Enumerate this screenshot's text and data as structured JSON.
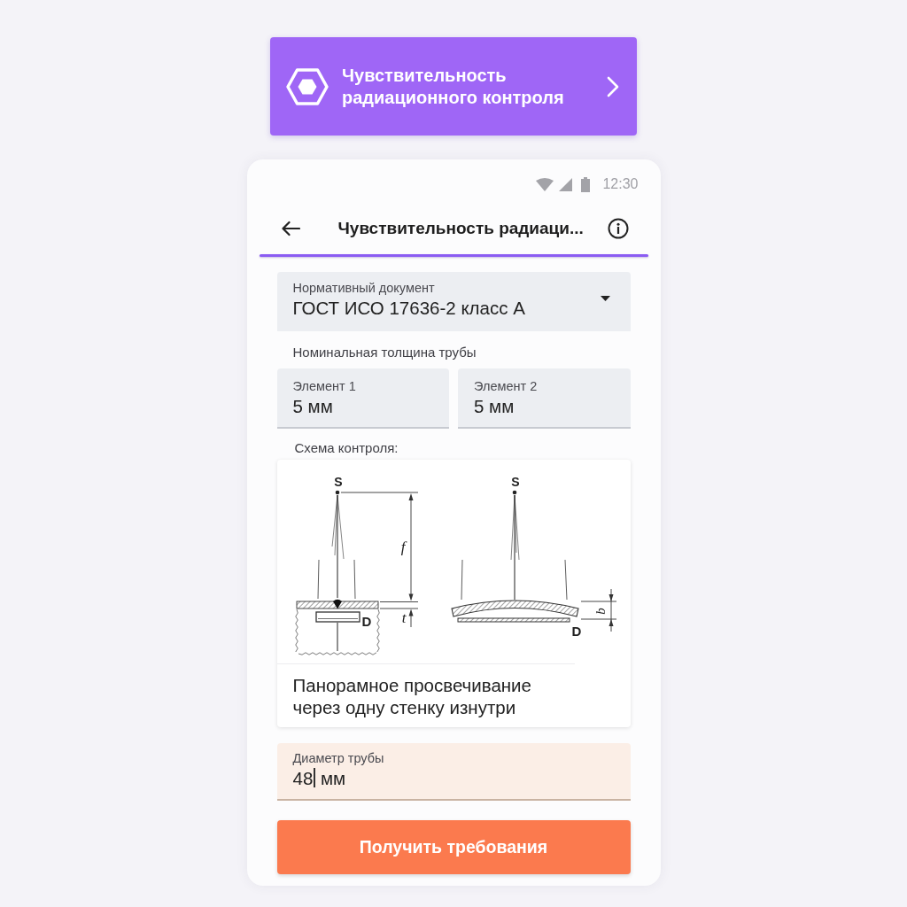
{
  "banner": {
    "title": "Чувствительность радиационного контроля"
  },
  "status_bar": {
    "time": "12:30"
  },
  "app_bar": {
    "title": "Чувствительность радиаци..."
  },
  "document_field": {
    "label": "Нормативный документ",
    "value": "ГОСТ ИСО 17636-2 класс А"
  },
  "thickness": {
    "label": "Номинальная толщина трубы",
    "fields": [
      {
        "label": "Элемент 1",
        "value": "5 мм"
      },
      {
        "label": "Элемент 2",
        "value": "5 мм"
      }
    ]
  },
  "scheme": {
    "label": "Схема контроля:",
    "diagram": {
      "left": {
        "source_label": "S",
        "distance_label": "f",
        "thickness_label": "t",
        "detector_label": "D"
      },
      "right": {
        "source_label": "S",
        "gap_label": "b",
        "detector_label": "D"
      }
    },
    "description": "Панорамное просвечивание через одну стенку изнутри"
  },
  "diameter_field": {
    "label": "Диаметр трубы",
    "value": "48",
    "unit": "мм",
    "focused": true
  },
  "submit_button": {
    "label": "Получить требования"
  }
}
